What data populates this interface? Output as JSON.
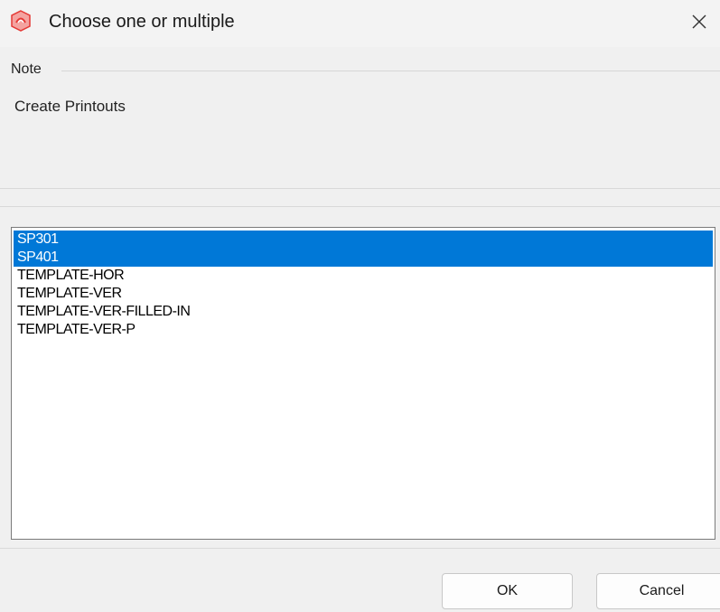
{
  "window": {
    "title": "Choose one or multiple",
    "icon": "app-logo-icon",
    "close_icon": "close-icon",
    "accent_color": "#e53935"
  },
  "note": {
    "legend": "Note",
    "text": "Create Printouts"
  },
  "list": {
    "selection_color": "#0078d7",
    "items": [
      {
        "label": "SP301",
        "selected": true
      },
      {
        "label": "SP401",
        "selected": true
      },
      {
        "label": "TEMPLATE-HOR",
        "selected": false
      },
      {
        "label": "TEMPLATE-VER",
        "selected": false
      },
      {
        "label": "TEMPLATE-VER-FILLED-IN",
        "selected": false
      },
      {
        "label": "TEMPLATE-VER-P",
        "selected": false
      }
    ]
  },
  "buttons": {
    "ok": "OK",
    "cancel": "Cancel"
  }
}
